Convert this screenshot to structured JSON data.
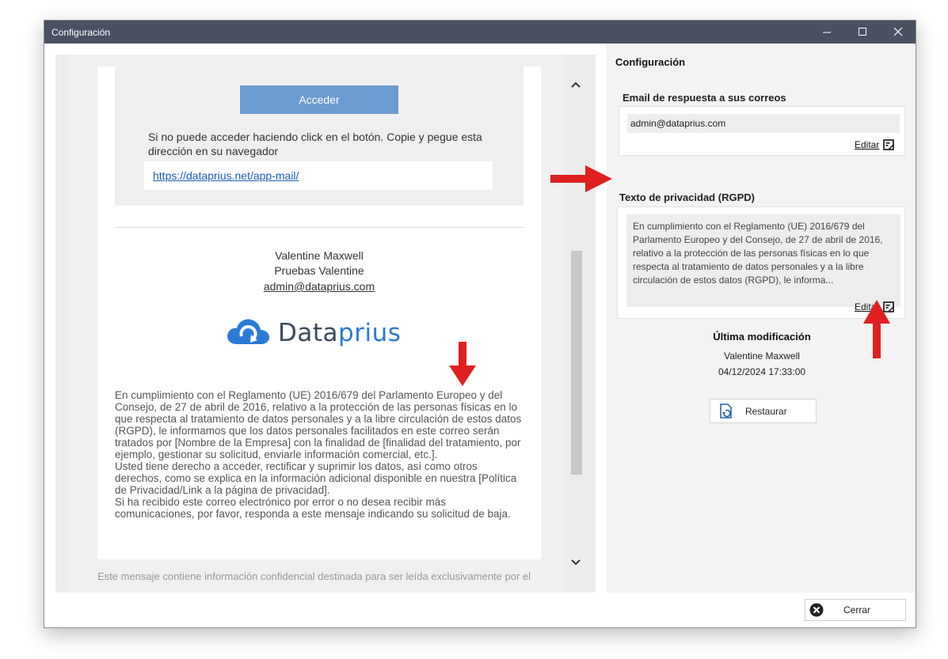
{
  "window": {
    "title": "Configuración"
  },
  "preview": {
    "button_label": "Acceder",
    "instructions": "Si no puede acceder haciendo click en el botón. Copie y pegue esta dirección en su navegador",
    "link": "https://dataprius.net/app-mail/",
    "signature": {
      "name": "Valentine Maxwell",
      "company": "Pruebas Valentine",
      "email": "admin@dataprius.com"
    },
    "logo_text_a": "Data",
    "logo_text_b": "prius",
    "legal_text_1": "En cumplimiento con el Reglamento (UE) 2016/679 del Parlamento Europeo y del Consejo, de 27 de abril de 2016, relativo a la protección de las personas físicas en lo que respecta al tratamiento de datos personales y a la libre circulación de estos datos (RGPD), le informamos que los datos personales facilitados en este correo serán tratados por [Nombre de la Empresa] con la finalidad de [finalidad del tratamiento, por ejemplo, gestionar su solicitud, enviarle información comercial, etc.].",
    "legal_text_2": "Usted tiene derecho a acceder, rectificar y suprimir los datos, así como otros derechos, como se explica en la información adicional disponible en nuestra [Política de Privacidad/Link a la página de privacidad].",
    "legal_text_3": "Si ha recibido este correo electrónico por error o no desea recibir más comunicaciones, por favor, responda a este mensaje indicando su solicitud de baja.",
    "footer_note": "Este mensaje contiene información confidencial destinada para ser leída exclusivamente por el"
  },
  "settings": {
    "heading": "Configuración",
    "reply_email": {
      "title": "Email de respuesta a sus correos",
      "value": "admin@dataprius.com",
      "edit_label": "Editar"
    },
    "privacy": {
      "title": "Texto de privacidad (RGPD)",
      "value": "En cumplimiento con el Reglamento (UE) 2016/679 del Parlamento Europeo y del Consejo, de 27 de abril de 2016, relativo a la protección de las personas físicas en lo que respecta al tratamiento de datos personales y a la libre circulación de estos datos (RGPD), le informa...",
      "edit_label": "Editar"
    },
    "last_modified": {
      "title": "Última modificación",
      "user": "Valentine Maxwell",
      "date": "04/12/2024 17:33:00"
    },
    "restore_label": "Restaurar"
  },
  "footer": {
    "close_label": "Cerrar"
  },
  "colors": {
    "accent_button": "#6b9bd1",
    "annotation_arrow": "#e02020",
    "titlebar": "#4a5160"
  }
}
